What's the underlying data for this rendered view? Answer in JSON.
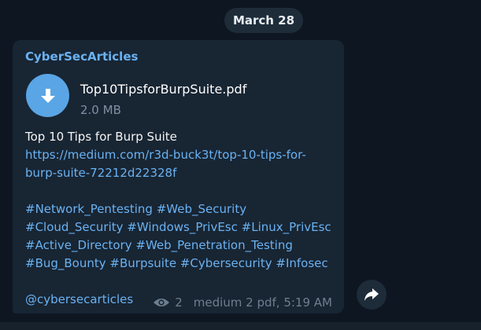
{
  "date_separator": "March 28",
  "message": {
    "channel_name": "CyberSecArticles",
    "file": {
      "name": "Top10TipsforBurpSuite.pdf",
      "size": "2.0 MB",
      "icon": "download-arrow-icon"
    },
    "text_title": "Top 10 Tips for Burp Suite",
    "link_line1": "https://medium.com/r3d-buck3t/top-10-tips-for-",
    "link_line2": "burp-suite-72212d22328f",
    "hashtags": [
      [
        "#Network_Pentesting",
        "#Web_Security"
      ],
      [
        "#Cloud_Security",
        "#Windows_PrivEsc",
        "#Linux_PrivEsc"
      ],
      [
        "#Active_Directory",
        "#Web_Penetration_Testing"
      ],
      [
        "#Bug_Bounty",
        "#Burpsuite",
        "#Cybersecurity",
        "#Infosec"
      ]
    ],
    "mention": "@cybersecarticles",
    "views": "2",
    "footer_info": "medium 2 pdf, 5:19 AM"
  },
  "colors": {
    "background": "#0e1621",
    "bubble": "#182533",
    "accent": "#6ab2f2",
    "file_icon": "#5aa5e5",
    "meta_text": "#6d7f8f"
  },
  "icons": {
    "views": "eye-icon",
    "share": "share-forward-icon"
  }
}
